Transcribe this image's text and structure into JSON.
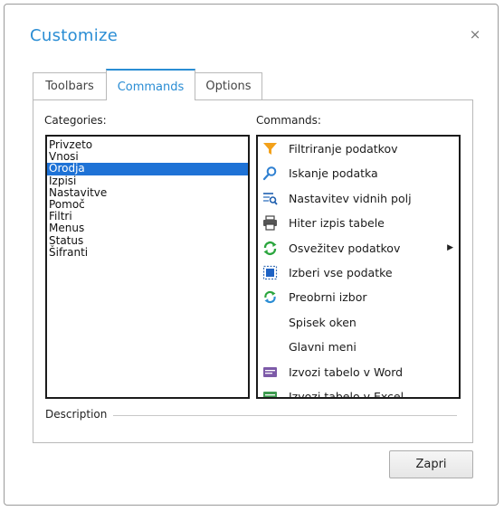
{
  "dialog": {
    "title": "Customize",
    "close_glyph": "×"
  },
  "tabs": [
    {
      "label": "Toolbars",
      "active": false
    },
    {
      "label": "Commands",
      "active": true
    },
    {
      "label": "Options",
      "active": false
    }
  ],
  "categories": {
    "label": "Categories:",
    "items": [
      "Privzeto",
      "Vnosi",
      "Orodja",
      "Izpisi",
      "Nastavitve",
      "Pomoč",
      "Filtri",
      "Menus",
      "Status",
      "Šifranti"
    ],
    "selected": "Orodja"
  },
  "commands": {
    "label": "Commands:",
    "items": [
      {
        "label": "Filtriranje podatkov",
        "icon": "funnel-icon"
      },
      {
        "label": "Iskanje podatka",
        "icon": "magnifier-icon"
      },
      {
        "label": "Nastavitev vidnih polj",
        "icon": "grid-search-icon"
      },
      {
        "label": "Hiter izpis tabele",
        "icon": "printer-icon"
      },
      {
        "label": "Osvežitev podatkov",
        "icon": "refresh-icon",
        "submenu": true
      },
      {
        "label": "Izberi vse podatke",
        "icon": "select-all-icon"
      },
      {
        "label": "Preobrni izbor",
        "icon": "invert-selection-icon"
      },
      {
        "label": "Spisek oken",
        "icon": null
      },
      {
        "label": "Glavni meni",
        "icon": null
      },
      {
        "label": "Izvozi tabelo v Word",
        "icon": "word-export-icon"
      },
      {
        "label": "Izvozi tabelo v Excel",
        "icon": "excel-export-icon"
      }
    ]
  },
  "description": {
    "label": "Description"
  },
  "buttons": {
    "close_label": "Zapri"
  },
  "colors": {
    "accent": "#2a8dd4",
    "selection": "#1e72d6"
  }
}
